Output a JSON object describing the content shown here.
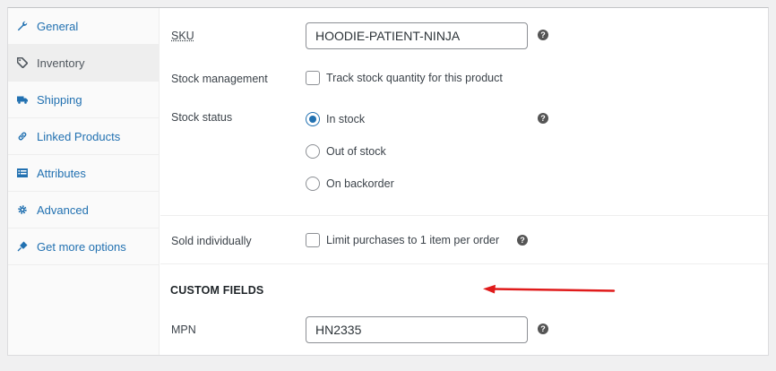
{
  "sidebar": {
    "items": [
      {
        "label": "General",
        "icon": "wrench-icon"
      },
      {
        "label": "Inventory",
        "icon": "tag-icon"
      },
      {
        "label": "Shipping",
        "icon": "truck-icon"
      },
      {
        "label": "Linked Products",
        "icon": "link-icon"
      },
      {
        "label": "Attributes",
        "icon": "list-icon"
      },
      {
        "label": "Advanced",
        "icon": "gear-icon"
      },
      {
        "label": "Get more options",
        "icon": "plugin-icon"
      }
    ],
    "active": "Inventory"
  },
  "inventory": {
    "sku": {
      "label": "SKU",
      "value": "HOODIE-PATIENT-NINJA"
    },
    "stock_management": {
      "label": "Stock management",
      "checkbox_label": "Track stock quantity for this product",
      "checked": false
    },
    "stock_status": {
      "label": "Stock status",
      "options": [
        "In stock",
        "Out of stock",
        "On backorder"
      ],
      "selected": "In stock"
    },
    "sold_individually": {
      "label": "Sold individually",
      "checkbox_label": "Limit purchases to 1 item per order",
      "checked": false
    }
  },
  "custom_fields": {
    "title": "CUSTOM FIELDS",
    "mpn": {
      "label": "MPN",
      "value": "HN2335"
    }
  },
  "help_glyph": "?",
  "colors": {
    "link": "#2271b1",
    "annotation_arrow": "#e01b1b"
  }
}
